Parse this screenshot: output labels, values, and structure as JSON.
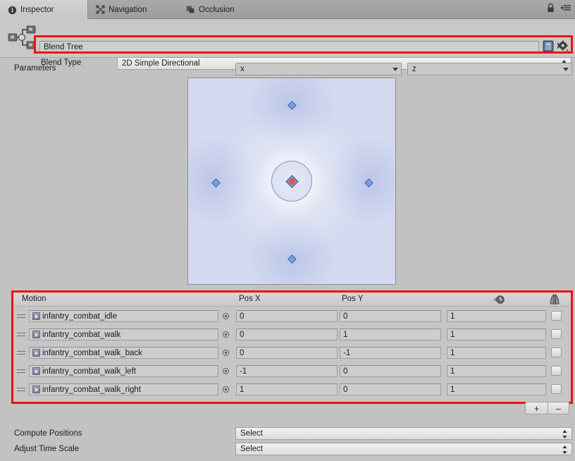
{
  "tabs": [
    {
      "label": "Inspector",
      "icon": "info-icon",
      "active": true
    },
    {
      "label": "Navigation",
      "icon": "navigation-icon",
      "active": false
    },
    {
      "label": "Occlusion",
      "icon": "occlusion-icon",
      "active": false
    }
  ],
  "window": {
    "lock_icon": "lock-icon",
    "menu_icon": "hamburger-menu-icon"
  },
  "header": {
    "object_name": "Blend Tree",
    "tree_icon": "blend-tree-node-icon",
    "book_icon": "reference-book-icon",
    "gear_icon": "gear-icon",
    "blend_type_label": "Blend Type",
    "blend_type_value": "2D Simple Directional"
  },
  "parameters": {
    "label": "Parameters",
    "param_x": "x",
    "param_z": "z"
  },
  "graph": {
    "nodes": [
      {
        "name": "up",
        "pos_x": 0,
        "pos_y": 1,
        "color": "#7a9de0"
      },
      {
        "name": "down",
        "pos_x": 0,
        "pos_y": -1,
        "color": "#7a9de0"
      },
      {
        "name": "left",
        "pos_x": -1,
        "pos_y": 0,
        "color": "#7a9de0"
      },
      {
        "name": "right",
        "pos_x": 1,
        "pos_y": 0,
        "color": "#7a9de0"
      },
      {
        "name": "center",
        "pos_x": 0,
        "pos_y": 0,
        "color": "#f0503c"
      }
    ],
    "selected_node": "center",
    "field_color": "#d3d9ef"
  },
  "motion_table": {
    "columns": {
      "motion": "Motion",
      "pos_x": "Pos X",
      "pos_y": "Pos Y",
      "time_scale_icon": "time-scale-clock-icon",
      "mirror_icon": "mirror-icon"
    },
    "rows": [
      {
        "motion": "infantry_combat_idle",
        "pos_x": "0",
        "pos_y": "0",
        "weight": "1",
        "mirror": false
      },
      {
        "motion": "infantry_combat_walk",
        "pos_x": "0",
        "pos_y": "1",
        "weight": "1",
        "mirror": false
      },
      {
        "motion": "infantry_combat_walk_back",
        "pos_x": "0",
        "pos_y": "-1",
        "weight": "1",
        "mirror": false
      },
      {
        "motion": "infantry_combat_walk_left",
        "pos_x": "-1",
        "pos_y": "0",
        "weight": "1",
        "mirror": false
      },
      {
        "motion": "infantry_combat_walk_right",
        "pos_x": "1",
        "pos_y": "0",
        "weight": "1",
        "mirror": false
      }
    ],
    "add_button": "+",
    "remove_button": "–"
  },
  "footer": {
    "compute_positions_label": "Compute Positions",
    "compute_positions_value": "Select",
    "adjust_time_scale_label": "Adjust Time Scale",
    "adjust_time_scale_value": "Select"
  },
  "highlights": {
    "accent_color": "#f01010"
  }
}
